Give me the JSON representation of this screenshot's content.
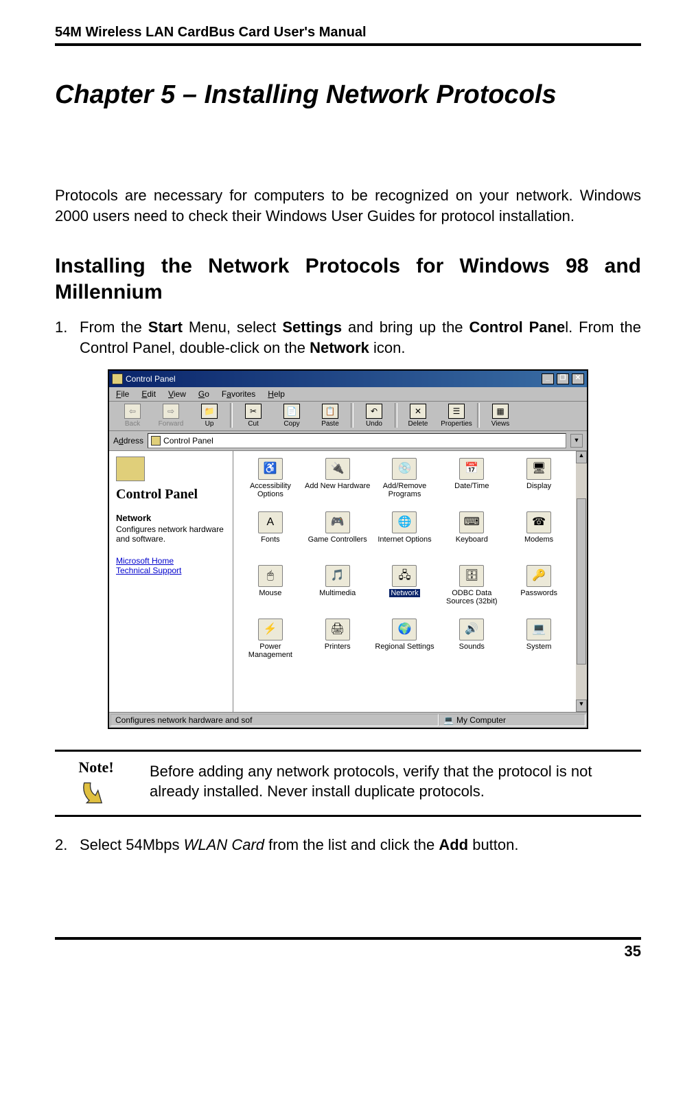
{
  "header": "54M Wireless LAN CardBus Card User's Manual",
  "chapter_title": "Chapter 5 – Installing Network Protocols",
  "intro": "Protocols are necessary for computers to be recognized on your network. Windows 2000 users need to check their Windows User Guides for protocol installation.",
  "section_title": "Installing the Network Protocols for Windows 98 and Millennium",
  "step1": {
    "num": "1.",
    "pre": "From the ",
    "start": "Start",
    "mid1": " Menu, select ",
    "settings": "Settings",
    "mid2": " and bring up the ",
    "cpanel": "Control Pane",
    "mid3": "l. From the Control Panel, double-click on the ",
    "network": "Network",
    "post": " icon."
  },
  "screenshot": {
    "title": "Control Panel",
    "menu": {
      "file": "File",
      "edit": "Edit",
      "view": "View",
      "go": "Go",
      "fav": "Favorites",
      "help": "Help"
    },
    "toolbar": {
      "back": "Back",
      "forward": "Forward",
      "up": "Up",
      "cut": "Cut",
      "copy": "Copy",
      "paste": "Paste",
      "undo": "Undo",
      "delete": "Delete",
      "properties": "Properties",
      "views": "Views"
    },
    "address_label": "Address",
    "address_value": "Control Panel",
    "side": {
      "title": "Control Panel",
      "selected": "Network",
      "desc": "Configures network hardware and software.",
      "link1": "Microsoft Home",
      "link2": "Technical Support"
    },
    "icons": {
      "r1c1": "Accessibility Options",
      "r1c2": "Add New Hardware",
      "r1c3": "Add/Remove Programs",
      "r1c4": "Date/Time",
      "r1c5": "Display",
      "r2c1": "Fonts",
      "r2c2": "Game Controllers",
      "r2c3": "Internet Options",
      "r2c4": "Keyboard",
      "r2c5": "Modems",
      "r3c1": "Mouse",
      "r3c2": "Multimedia",
      "r3c3": "Network",
      "r3c4": "ODBC Data Sources (32bit)",
      "r3c5": "Passwords",
      "r4c1": "Power Management",
      "r4c2": "Printers",
      "r4c3": "Regional Settings",
      "r4c4": "Sounds",
      "r4c5": "System"
    },
    "status_left": "Configures network hardware and sof",
    "status_right": "My Computer"
  },
  "note": {
    "label": "Note!",
    "body": "Before adding any network protocols, verify that the protocol is not already installed. Never install duplicate protocols."
  },
  "step2": {
    "num": "2.",
    "pre": "Select    54Mbps ",
    "italic": "WLAN Card",
    "mid": " from the list and click the ",
    "add": "Add",
    "post": " button."
  },
  "page_number": "35"
}
